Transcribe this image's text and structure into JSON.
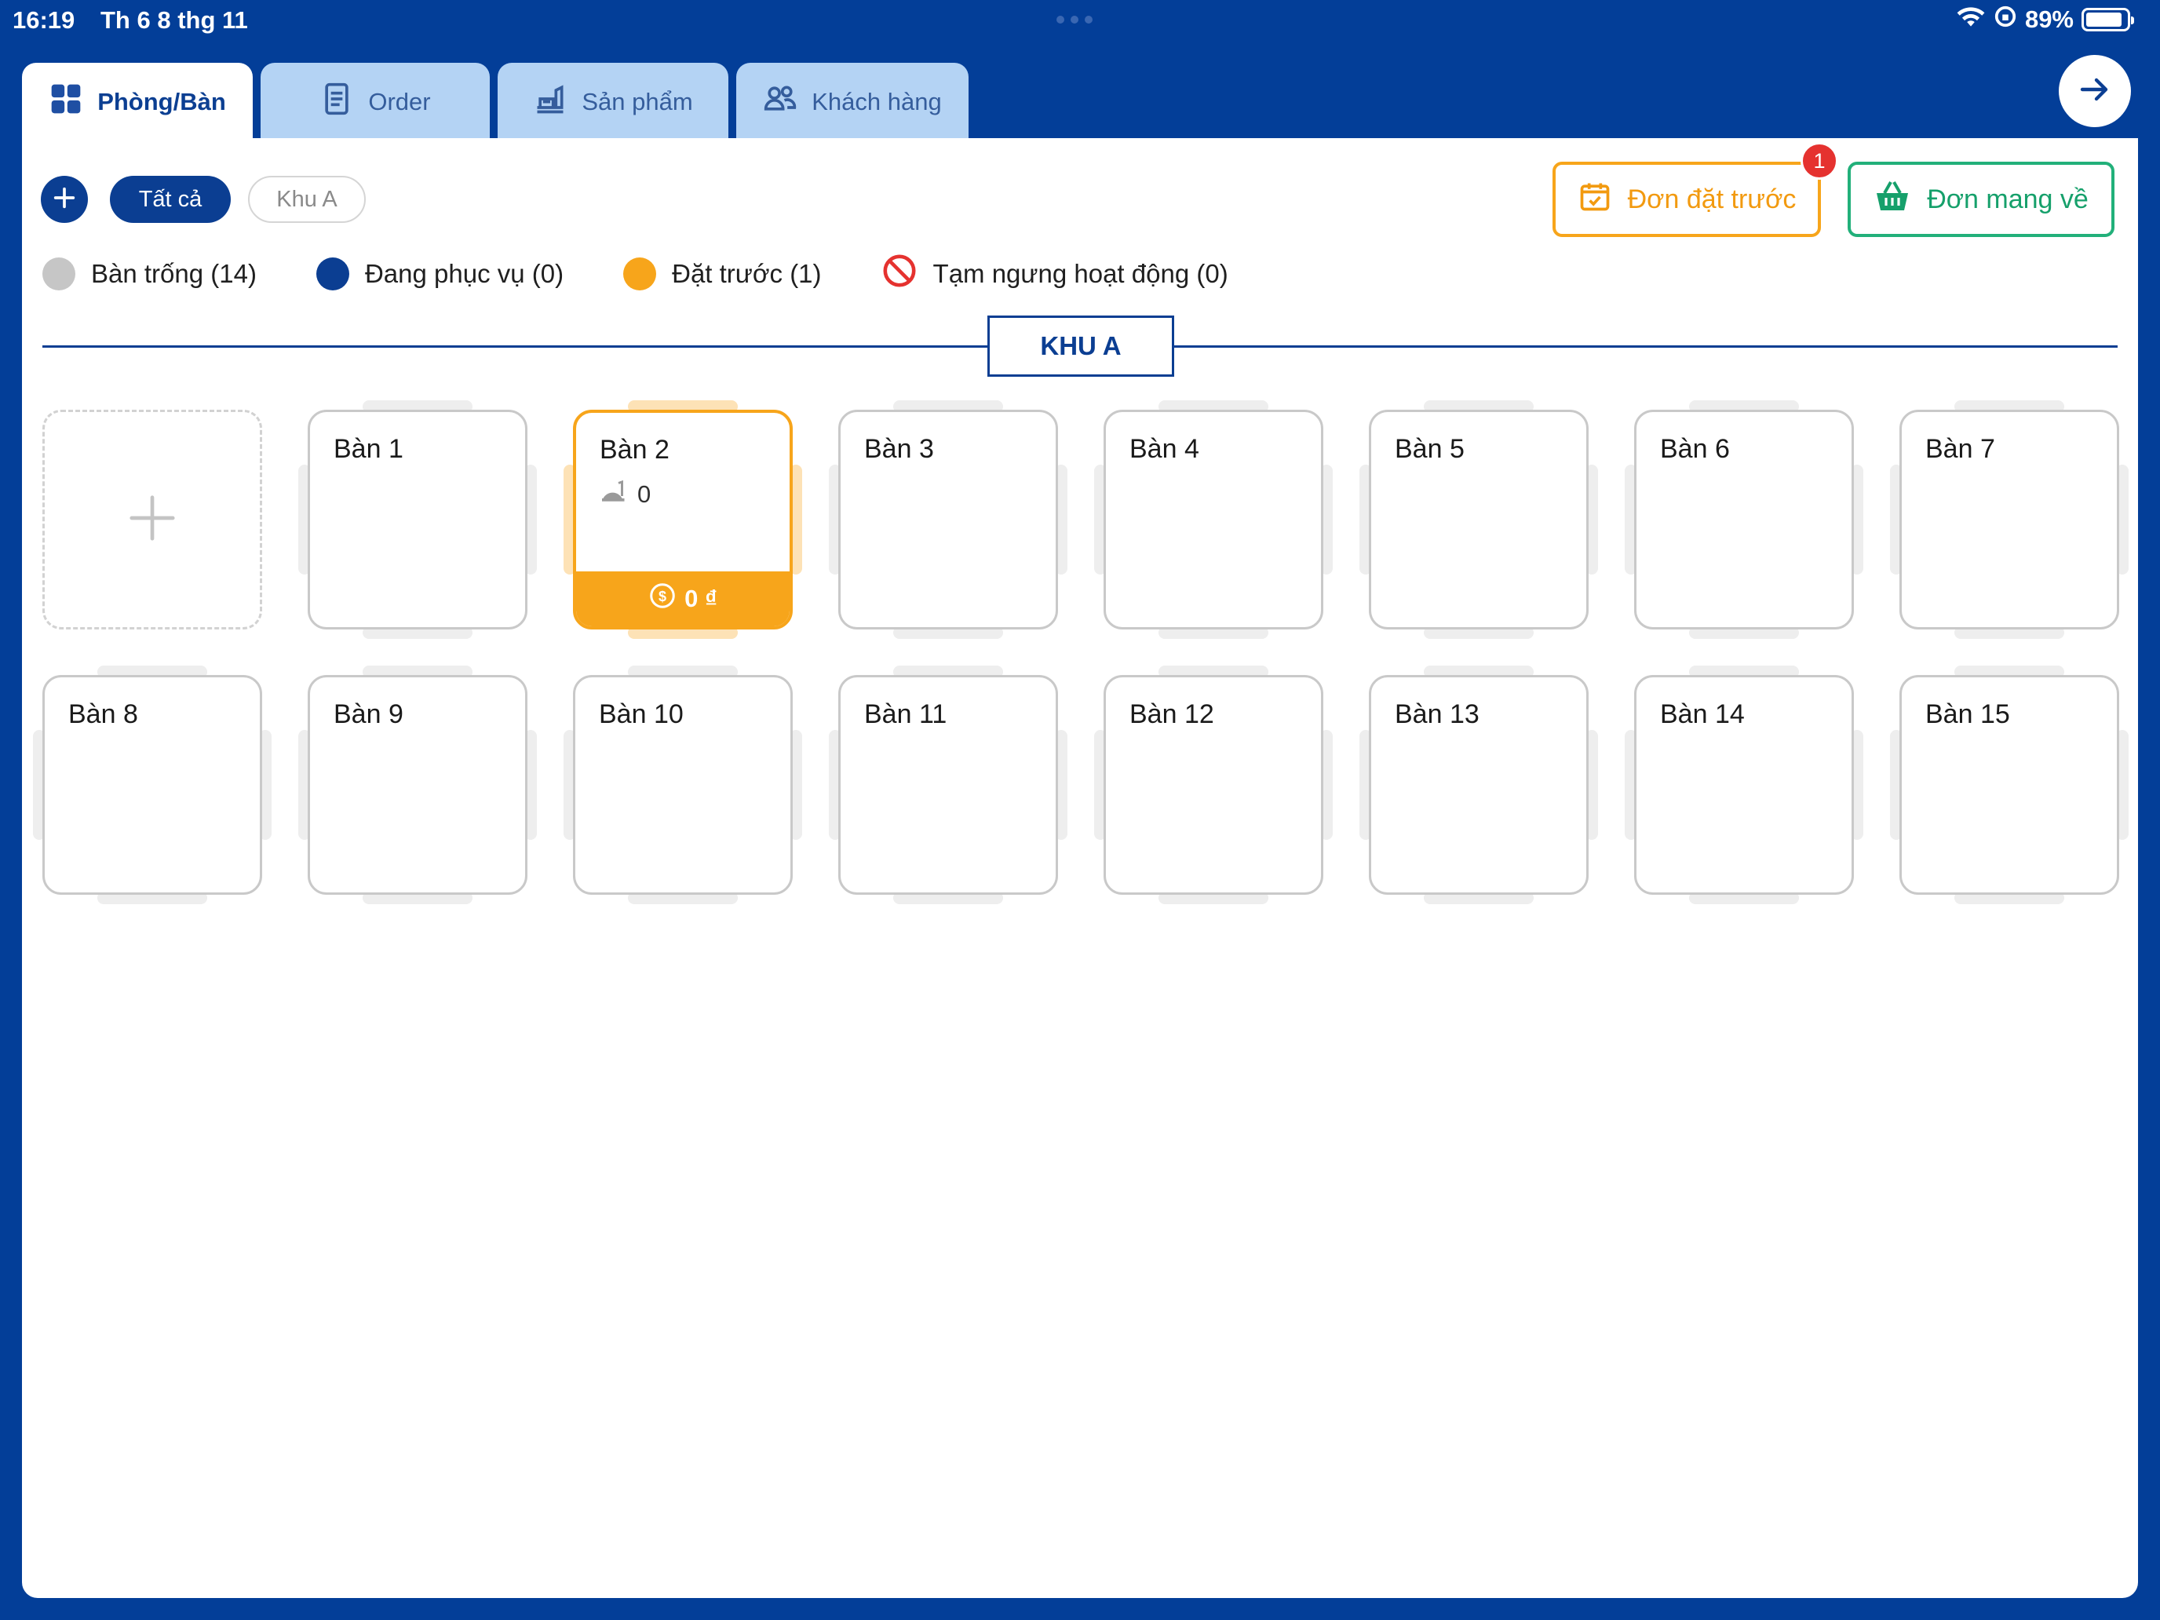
{
  "status_bar": {
    "time": "16:19",
    "date": "Th 6 8 thg 11",
    "battery": "89%",
    "battery_level": 0.89
  },
  "tabs": [
    {
      "label": "Phòng/Bàn",
      "icon": "grid-icon",
      "active": true
    },
    {
      "label": "Order",
      "icon": "document-icon",
      "active": false
    },
    {
      "label": "Sản phẩm",
      "icon": "food-tray-icon",
      "active": false
    },
    {
      "label": "Khách hàng",
      "icon": "users-icon",
      "active": false
    }
  ],
  "filters": {
    "all_label": "Tất cả",
    "area_label": "Khu A",
    "selected": "Tất cả"
  },
  "actions": {
    "preorder_label": "Đơn đặt trước",
    "preorder_badge": "1",
    "takeaway_label": "Đơn mang về"
  },
  "legend": [
    {
      "label": "Bàn trống (14)",
      "color": "#c6c6c6"
    },
    {
      "label": "Đang phục vụ (0)",
      "color": "#0b3e92"
    },
    {
      "label": "Đặt trước (1)",
      "color": "#f7a51b"
    },
    {
      "label": "Tạm ngưng hoạt động (0)",
      "color": "#e5322f"
    }
  ],
  "section": {
    "title": "KHU A"
  },
  "tables": [
    {
      "name": "Bàn 1",
      "status": "empty"
    },
    {
      "name": "Bàn 2",
      "status": "reserved",
      "guests": "0",
      "total": "0 ₫"
    },
    {
      "name": "Bàn 3",
      "status": "empty"
    },
    {
      "name": "Bàn 4",
      "status": "empty"
    },
    {
      "name": "Bàn 5",
      "status": "empty"
    },
    {
      "name": "Bàn 6",
      "status": "empty"
    },
    {
      "name": "Bàn 7",
      "status": "empty"
    },
    {
      "name": "Bàn 8",
      "status": "empty"
    },
    {
      "name": "Bàn 9",
      "status": "empty"
    },
    {
      "name": "Bàn 10",
      "status": "empty"
    },
    {
      "name": "Bàn 11",
      "status": "empty"
    },
    {
      "name": "Bàn 12",
      "status": "empty"
    },
    {
      "name": "Bàn 13",
      "status": "empty"
    },
    {
      "name": "Bàn 14",
      "status": "empty"
    },
    {
      "name": "Bàn 15",
      "status": "empty"
    }
  ],
  "colors": {
    "brand": "#033e98",
    "accent_orange": "#f7a51b",
    "accent_green": "#22b07a",
    "badge_red": "#e5322f"
  }
}
